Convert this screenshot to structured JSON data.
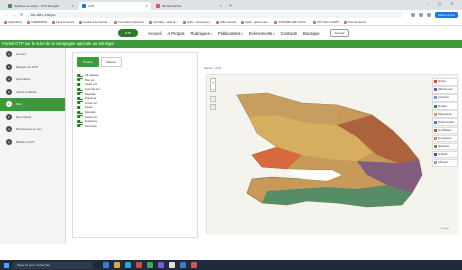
{
  "browser": {
    "tabs": [
      {
        "label": "Système en Ligne - GTP Sénégal",
        "active": false,
        "favicon_color": "#4a8a4a"
      },
      {
        "label": "GTP",
        "active": true,
        "favicon_color": "#1a73e8"
      },
      {
        "label": "Mit Recherche",
        "active": false,
        "favicon_color": "#d9534f"
      }
    ],
    "new_tab": "+",
    "window_controls": "–  ▢  ✕",
    "url": "192.168.1.190/gtp/",
    "update_label": "Mettre à jour",
    "bookmarks": [
      "Applications",
      "CARDERPAD",
      "Pavé de lecture",
      "Gestion des réservat...",
      "Formulaire d'obtention",
      "Openlaby - carte de...",
      "Ajaifo - optimal des...",
      "Office Simulet",
      "Ajaifo - gestion des...",
      "CONSIPE-CRIN UN DL...",
      "GTP Ulocs CARPT",
      "Tous les favoris"
    ]
  },
  "site": {
    "logo_text": "GTP",
    "menu": [
      {
        "label": "Accueil",
        "has_dropdown": false
      },
      {
        "label": "A Propos",
        "has_dropdown": false
      },
      {
        "label": "Rubriques",
        "has_dropdown": true
      },
      {
        "label": "Publications",
        "has_dropdown": true
      },
      {
        "label": "Evènements",
        "has_dropdown": true
      },
      {
        "label": "Contacts",
        "has_dropdown": false
      },
      {
        "label": "Boutique",
        "has_dropdown": false
      }
    ],
    "account_label": "Accueil"
  },
  "banner": {
    "title": "Portail GTP sur le suivi de la campagne agricole au Sénégal"
  },
  "sidebar": {
    "items": [
      {
        "label": "Accueil",
        "active": false
      },
      {
        "label": "Équipes du GTP",
        "active": false
      },
      {
        "label": "Agriculture",
        "active": false
      },
      {
        "label": "Climat et Météo",
        "active": false
      },
      {
        "label": "Sols",
        "active": true
      },
      {
        "label": "Eco-Impact",
        "active": false
      },
      {
        "label": "Ressources en eau",
        "active": false
      },
      {
        "label": "Bulletins GTP",
        "active": false
      }
    ]
  },
  "panel": {
    "tabs": [
      {
        "label": "Produit",
        "active": true
      },
      {
        "label": "Rélevé",
        "active": false
      }
    ],
    "layers": [
      "All Classes",
      "Bon sol",
      "Arrête sol",
      "Corrodé sol",
      "Dégradé",
      "Préservé",
      "Limite sol",
      "Kaolin",
      "Dégradé",
      "Ouest sol",
      "Endorées",
      "Ferrosols"
    ]
  },
  "map": {
    "header_prefix": "Source :",
    "header_link": "GTP",
    "zoom_in": "+",
    "zoom_out": "−",
    "tool1": "⌂",
    "tool2": "⤢",
    "legend": [
      {
        "label": "Arênas",
        "color": "#e04a2a"
      },
      {
        "label": "Affleurement",
        "color": "#7a5a9a"
      },
      {
        "label": "Lacustres",
        "color": "#6aa0c8"
      },
      {
        "label": "Fluviaux",
        "color": "#2f8a6a"
      },
      {
        "label": "Halomorphe",
        "color": "#c8a060"
      },
      {
        "label": "Hydromorphes",
        "color": "#3a8ac8"
      },
      {
        "label": "Ferralitiques",
        "color": "#b85a3a"
      },
      {
        "label": "Ferrugineux",
        "color": "#d89040"
      },
      {
        "label": "Subarides",
        "color": "#8a8a3a"
      },
      {
        "label": "Vertisols",
        "color": "#5a4a8a"
      },
      {
        "label": "Lithosols",
        "color": "#9a9aa0"
      }
    ],
    "attribution": "© Leaflet"
  },
  "taskbar": {
    "search_placeholder": "Taper ici pour rechercher",
    "tray_text": "FRA  10:32",
    "apps": [
      "#3a7bd5",
      "#e8a33a",
      "#2aa3d9",
      "#d04a4a",
      "#3aa75a",
      "#7a5ad5",
      "#e0e0e0",
      "#3a7bd5",
      "#d9534f"
    ]
  }
}
